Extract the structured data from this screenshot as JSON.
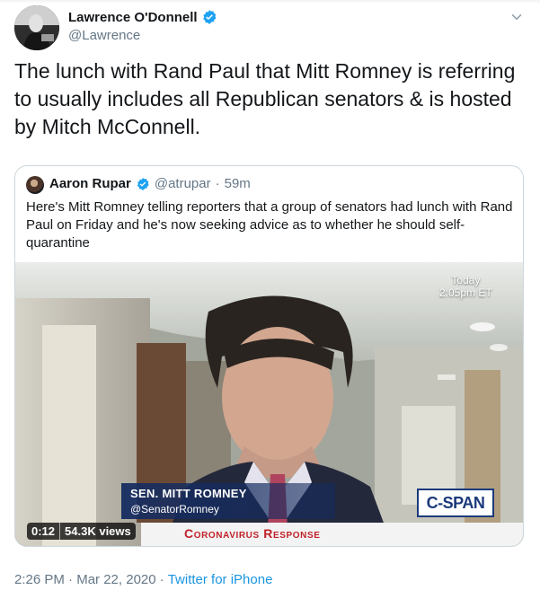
{
  "tweet": {
    "author_name": "Lawrence O'Donnell",
    "author_handle": "@Lawrence",
    "text": "The lunch with Rand Paul that Mitt Romney is referring to usually includes all Republican senators & is hosted by Mitch McConnell.",
    "time": "2:26 PM",
    "date": "Mar 22, 2020",
    "source": "Twitter for iPhone",
    "separator": "·"
  },
  "quoted": {
    "author_name": "Aaron Rupar",
    "author_handle": "@atrupar",
    "age": "59m",
    "text": "Here's Mitt Romney telling reporters that a group of senators had lunch with Rand Paul on Friday and he's now seeking advice as to whether he should self-quarantine",
    "video": {
      "duration": "0:12",
      "views": "54.3K views",
      "today_label": "Today",
      "time_label": "2:05pm ET",
      "lower_third_name": "SEN. MITT ROMNEY",
      "lower_third_handle": "@SenatorRomney",
      "network_logo": "C-SPAN",
      "banner": "Coronavirus Response"
    }
  },
  "colors": {
    "link_blue": "#1b95e0",
    "verified_blue": "#1da1f2",
    "secondary_text": "#657786",
    "banner_red": "#c0222a"
  },
  "icons": {
    "verified": "verified-badge-icon",
    "menu": "chevron-down-icon"
  }
}
